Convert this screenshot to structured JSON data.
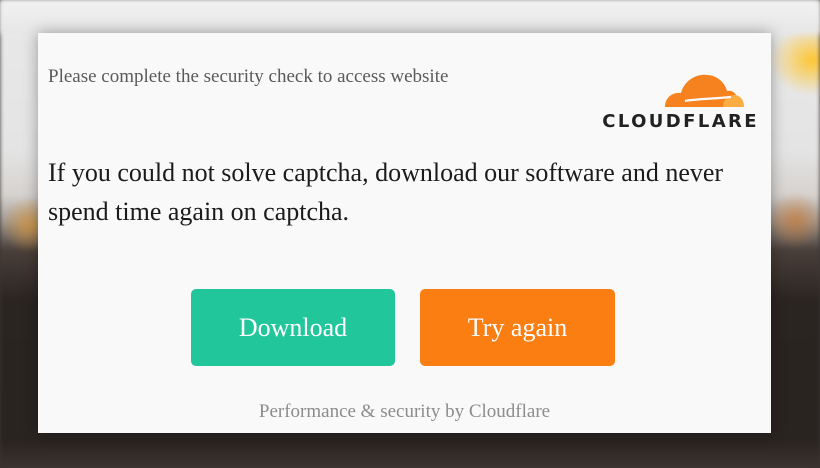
{
  "dialog": {
    "subtitle": "Please complete the security check to access website",
    "logo": {
      "wordmark": "CLOUDFLARE",
      "icon": "cloudflare-cloud-icon",
      "colors": {
        "primary": "#f6821f",
        "secondary": "#fbad41"
      }
    },
    "headline": "If you could not solve captcha, download our software and never spend time again on captcha.",
    "buttons": {
      "download_label": "Download",
      "retry_label": "Try again"
    },
    "footer": "Performance & security by Cloudflare"
  },
  "colors": {
    "download_button": "#22c69b",
    "retry_button": "#fb7e13",
    "dialog_background": "#f9f9f9"
  }
}
